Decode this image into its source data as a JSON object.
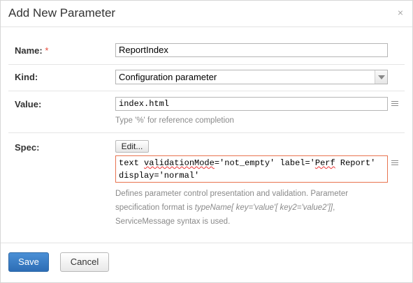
{
  "dialog": {
    "title": "Add New Parameter",
    "close_glyph": "×"
  },
  "name": {
    "label": "Name:",
    "required_marker": "*",
    "value": "ReportIndex"
  },
  "kind": {
    "label": "Kind:",
    "selected": "Configuration parameter"
  },
  "value_field": {
    "label": "Value:",
    "value": "index.html",
    "hint": "Type '%' for reference completion"
  },
  "spec": {
    "label": "Spec:",
    "edit_button": "Edit...",
    "line1_a": "text ",
    "line1_b": "validationMode",
    "line1_c": "='not_empty' label='",
    "line1_d": "Perf",
    "line1_e": " Report'",
    "line2": "display='normal'",
    "hint_line1": "Defines parameter control presentation and validation. Parameter",
    "hint_line2_a": "specification format is ",
    "hint_line2_b": "typeName[ key='value'[ key2='value2']]",
    "hint_line2_c": ",",
    "hint_line3": "ServiceMessage syntax is used."
  },
  "footer": {
    "save": "Save",
    "cancel": "Cancel"
  },
  "icons": {
    "expand": "expand-editor-icon",
    "dropdown": "chevron-down-icon",
    "close": "close-icon"
  },
  "colors": {
    "save_button": "#2d6db5",
    "required": "#e74c3c",
    "spec_border": "#e8734f"
  }
}
